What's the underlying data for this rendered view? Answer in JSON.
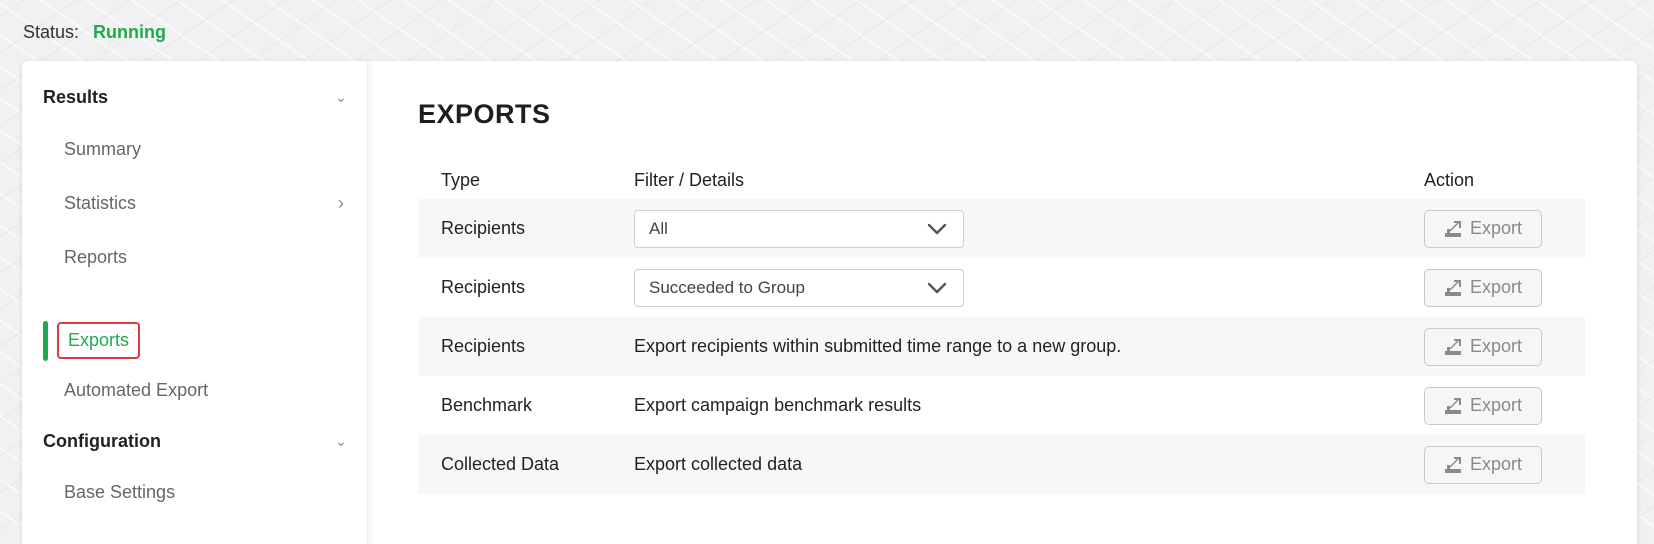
{
  "status": {
    "label": "Status:",
    "value": "Running"
  },
  "sidebar": {
    "results_label": "Results",
    "items": [
      {
        "label": "Summary"
      },
      {
        "label": "Statistics"
      },
      {
        "label": "Reports"
      },
      {
        "label": "Exports"
      },
      {
        "label": "Automated Export"
      }
    ],
    "configuration_label": "Configuration",
    "config_items": [
      {
        "label": "Base Settings"
      }
    ]
  },
  "main": {
    "title": "EXPORTS",
    "columns": {
      "type": "Type",
      "filter": "Filter / Details",
      "action": "Action"
    },
    "rows": [
      {
        "type": "Recipients",
        "filter_kind": "select",
        "filter": "All",
        "action": "Export"
      },
      {
        "type": "Recipients",
        "filter_kind": "select",
        "filter": "Succeeded to Group",
        "action": "Export"
      },
      {
        "type": "Recipients",
        "filter_kind": "text",
        "filter": "Export recipients within submitted time range to a new group.",
        "action": "Export"
      },
      {
        "type": "Benchmark",
        "filter_kind": "text",
        "filter": "Export campaign benchmark results",
        "action": "Export"
      },
      {
        "type": "Collected Data",
        "filter_kind": "text",
        "filter": "Export collected data",
        "action": "Export"
      }
    ]
  },
  "colors": {
    "accent": "#1faa4d",
    "highlight_border": "#d93a3a"
  },
  "icons": {
    "section_toggle": "chevron-down-icon",
    "submenu": "chevron-right-icon",
    "select": "chevron-down-icon",
    "export": "export-icon"
  }
}
